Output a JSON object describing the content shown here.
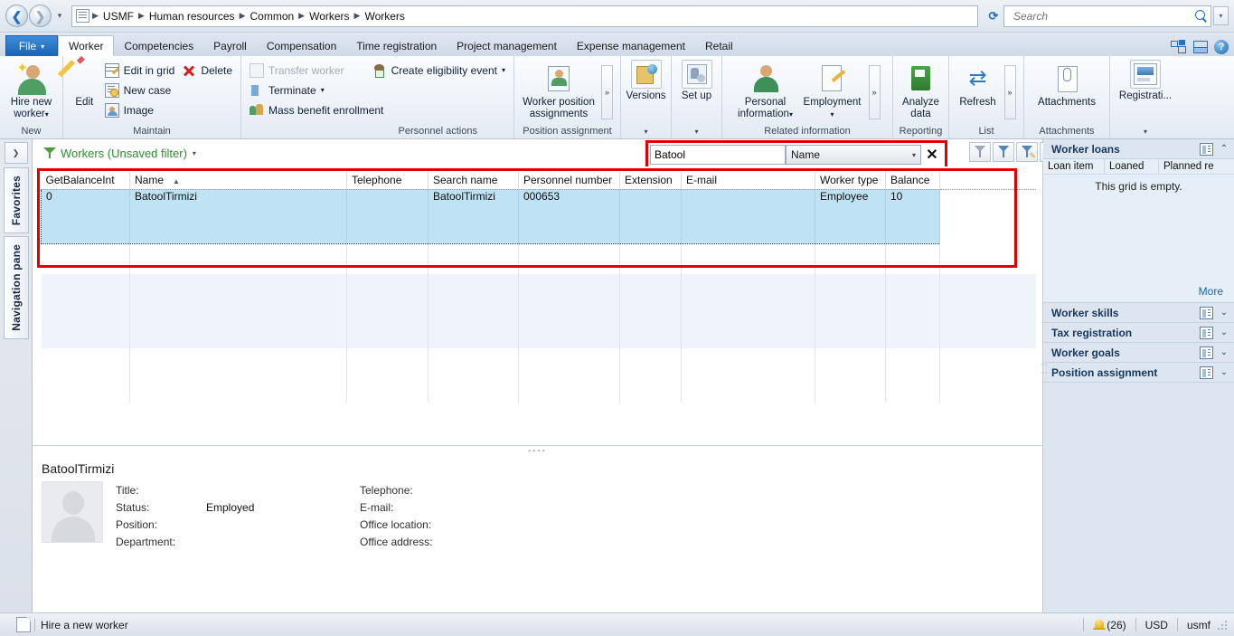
{
  "addressbar": {
    "breadcrumb": [
      "USMF",
      "Human resources",
      "Common",
      "Workers",
      "Workers"
    ],
    "search_placeholder": "Search",
    "search_value": ""
  },
  "ribbon": {
    "file_tab": "File",
    "tabs": [
      {
        "label": "Worker",
        "active": true
      },
      {
        "label": "Competencies",
        "active": false
      },
      {
        "label": "Payroll",
        "active": false
      },
      {
        "label": "Compensation",
        "active": false
      },
      {
        "label": "Time registration",
        "active": false
      },
      {
        "label": "Project management",
        "active": false
      },
      {
        "label": "Expense management",
        "active": false
      },
      {
        "label": "Retail",
        "active": false
      }
    ],
    "groups": {
      "new": {
        "title": "New",
        "hire_label_line1": "Hire new",
        "hire_label_line2": "worker"
      },
      "maintain": {
        "title": "Maintain",
        "edit": "Edit",
        "edit_in_grid": "Edit in grid",
        "delete": "Delete",
        "new_case": "New case",
        "image": "Image"
      },
      "personnel_actions": {
        "title": "Personnel actions",
        "transfer_worker": "Transfer worker",
        "terminate": "Terminate",
        "mass_benefit_enrollment": "Mass benefit enrollment",
        "create_eligibility_event": "Create eligibility event"
      },
      "position_assignment": {
        "title": "Position assignment",
        "worker_position_line1": "Worker position",
        "worker_position_line2": "assignments"
      },
      "versions": {
        "label": "Versions"
      },
      "setup": {
        "label": "Set up"
      },
      "related_information": {
        "title": "Related information",
        "personal_line1": "Personal",
        "personal_line2": "information",
        "employment": "Employment"
      },
      "reporting": {
        "title": "Reporting",
        "analyze_line1": "Analyze",
        "analyze_line2": "data"
      },
      "list": {
        "title": "List",
        "refresh": "Refresh"
      },
      "attachments": {
        "title": "Attachments",
        "label": "Attachments"
      },
      "registration": {
        "label": "Registrati..."
      }
    }
  },
  "left_strip": {
    "favorites": "Favorites",
    "navigation_pane": "Navigation pane"
  },
  "list_page": {
    "title": "Workers (Unsaved filter)",
    "filter_value": "Batool",
    "filter_field": "Name",
    "clear_filter": "✕",
    "columns": [
      "GetBalanceInt",
      "Name",
      "Telephone",
      "Search name",
      "Personnel number",
      "Extension",
      "E-mail",
      "Worker type",
      "Balance"
    ],
    "sorted_column": "Name",
    "rows": [
      {
        "GetBalanceInt": "0",
        "Name": "BatoolTirmizi",
        "Telephone": "",
        "Search name": "BatoolTirmizi",
        "Personnel number": "000653",
        "Extension": "",
        "E-mail": "",
        "Worker type": "Employee",
        "Balance": "10",
        "selected": true
      }
    ]
  },
  "detail": {
    "name": "BatoolTirmizi",
    "left_fields": [
      {
        "label": "Title:",
        "value": ""
      },
      {
        "label": "Status:",
        "value": "Employed"
      },
      {
        "label": "Position:",
        "value": ""
      },
      {
        "label": "Department:",
        "value": ""
      }
    ],
    "right_fields": [
      {
        "label": "Telephone:",
        "value": ""
      },
      {
        "label": "E-mail:",
        "value": ""
      },
      {
        "label": "Office location:",
        "value": ""
      },
      {
        "label": "Office address:",
        "value": ""
      }
    ]
  },
  "factbox": {
    "worker_loans": {
      "title": "Worker loans",
      "columns": [
        "Loan item",
        "Loaned",
        "Planned re"
      ],
      "empty_message": "This grid is empty.",
      "more": "More"
    },
    "sections": [
      {
        "title": "Worker skills"
      },
      {
        "title": "Tax registration"
      },
      {
        "title": "Worker goals"
      },
      {
        "title": "Position assignment"
      }
    ]
  },
  "statusbar": {
    "message": "Hire a new worker",
    "notifications": "(26)",
    "currency": "USD",
    "company": "usmf"
  },
  "colors": {
    "accent_blue": "#1b63b5",
    "highlight_red": "#e10000",
    "selection_blue": "#bfe2f4",
    "title_green": "#2e8b30",
    "link_blue": "#1665b5"
  }
}
